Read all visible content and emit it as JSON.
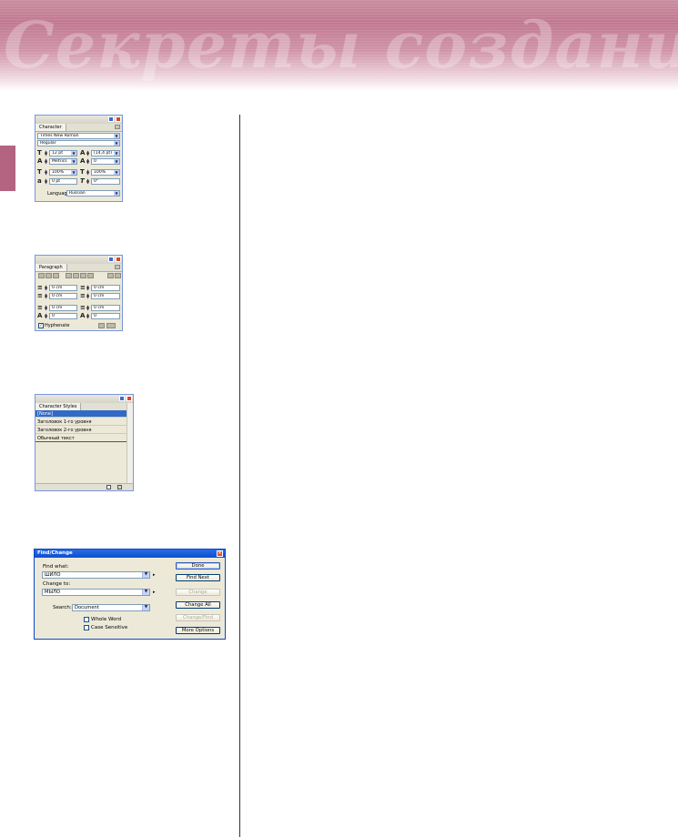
{
  "banner": {
    "text": "Секреты создания стилей"
  },
  "character_panel": {
    "tab": "Character",
    "font_family": "Times New Roman",
    "font_style": "Regular",
    "font_size": "12 pt",
    "leading": "(14,4 pt)",
    "kerning": "Metrics",
    "tracking": "0",
    "vertical_scale": "100%",
    "horizontal_scale": "100%",
    "baseline_shift": "0 pt",
    "skew": "0°",
    "language_label": "Language:",
    "language": "Russian"
  },
  "paragraph_panel": {
    "tab": "Paragraph",
    "left_indent": "0 cm",
    "right_indent": "0 cm",
    "first_line_indent": "0 cm",
    "last_line_indent": "0 cm",
    "space_before": "0 cm",
    "space_after": "0 cm",
    "drop_cap_lines": "0",
    "drop_cap_chars": "0",
    "hyphenate_label": "Hyphenate",
    "hyphenate_checked": true
  },
  "character_styles_panel": {
    "tab": "Character Styles",
    "items": [
      "[None]",
      "Заголовок 1-го уровня",
      "Заголовок 2-го уровня",
      "Обычный текст"
    ]
  },
  "find_change_dialog": {
    "title": "Find/Change",
    "find_what_label": "Find what:",
    "find_what_value": "ШИЛО",
    "change_to_label": "Change to:",
    "change_to_value": "МЫЛО",
    "search_label": "Search:",
    "search_value": "Document",
    "whole_word_label": "Whole Word",
    "case_sensitive_label": "Case Sensitive",
    "buttons": {
      "done": "Done",
      "find_next": "Find Next",
      "change": "Change",
      "change_all": "Change All",
      "change_find": "Change/Find",
      "more_options": "More Options"
    }
  }
}
